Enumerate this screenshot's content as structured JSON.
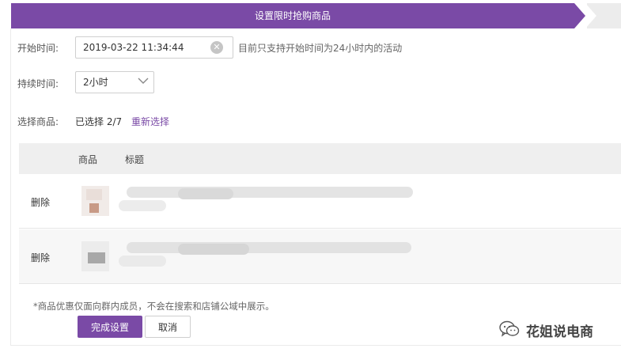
{
  "header": {
    "step_title": "设置限时抢购商品"
  },
  "form": {
    "start_time_label": "开始时间:",
    "start_time_value": "2019-03-22 11:34:44",
    "start_time_hint": "目前只支持开始时间为24小时内的活动",
    "duration_label": "持续时间:",
    "duration_value": "2小时",
    "select_goods_label": "选择商品:",
    "selected_text": "已选择 2/7",
    "reselect_label": "重新选择"
  },
  "table": {
    "columns": [
      "商品",
      "标题"
    ],
    "rows": [
      {
        "action": "删除"
      },
      {
        "action": "删除"
      }
    ]
  },
  "note": "*商品优惠仅面向群内成员，不会在搜索和店铺公域中展示。",
  "buttons": {
    "confirm": "完成设置",
    "cancel": "取消"
  },
  "watermark": {
    "text": "花姐说电商",
    "icon": "wechat-icon"
  },
  "colors": {
    "accent": "#7a4aa6"
  }
}
